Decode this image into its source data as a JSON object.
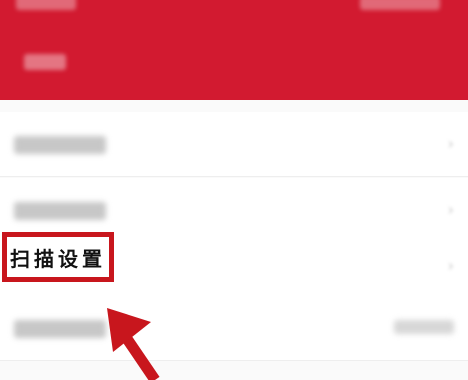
{
  "highlight": {
    "label": "扫描设置"
  },
  "list": {
    "rows": [
      {
        "chevron": "›"
      },
      {
        "chevron": "›"
      },
      {
        "chevron": "›"
      },
      {
        "chevron": "›"
      }
    ]
  },
  "colors": {
    "header_red": "#d21a30",
    "annotation_red": "#c8161d"
  },
  "icons": {
    "chevron": "chevron-right-icon",
    "annotation_arrow": "arrow-up-left-icon"
  }
}
